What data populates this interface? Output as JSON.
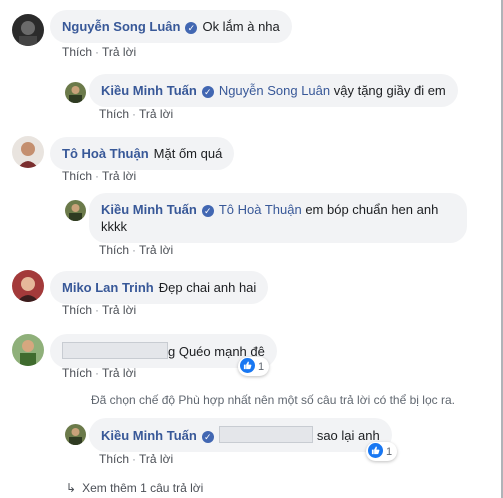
{
  "actions": {
    "like": "Thích",
    "reply": "Trả lời",
    "separator": "·"
  },
  "comments": [
    {
      "name": "Nguyễn Song Luân",
      "verified": true,
      "text": "Ok lắm à nha"
    },
    {
      "name": "Kiều Minh Tuấn",
      "verified": true,
      "mention": "Nguyễn Song Luân",
      "text": "vậy tặng giầy đi em"
    },
    {
      "name": "Tô Hoà Thuận",
      "verified": false,
      "text": "Mặt ốm quá"
    },
    {
      "name": "Kiều Minh Tuấn",
      "verified": true,
      "mention": "Tô Hoà Thuận",
      "text": "em bóp chuẩn hen anh kkkk"
    },
    {
      "name": "Miko Lan Trinh",
      "verified": false,
      "text": "Đẹp chai anh hai"
    },
    {
      "name": "",
      "verified": false,
      "text": "g Quéo mạnh đê",
      "reactions": "1"
    },
    {
      "name": "Kiều Minh Tuấn",
      "verified": true,
      "text": "sao lại anh",
      "reactions": "1"
    }
  ],
  "filter_notice": "Đã chọn chế độ Phù hợp nhất nên một số câu trả lời có thể bị lọc ra.",
  "view_more": "Xem thêm 1 câu trả lời",
  "colors": {
    "name": "#385898",
    "bubble": "#f2f3f5",
    "like": "#1877f2"
  }
}
